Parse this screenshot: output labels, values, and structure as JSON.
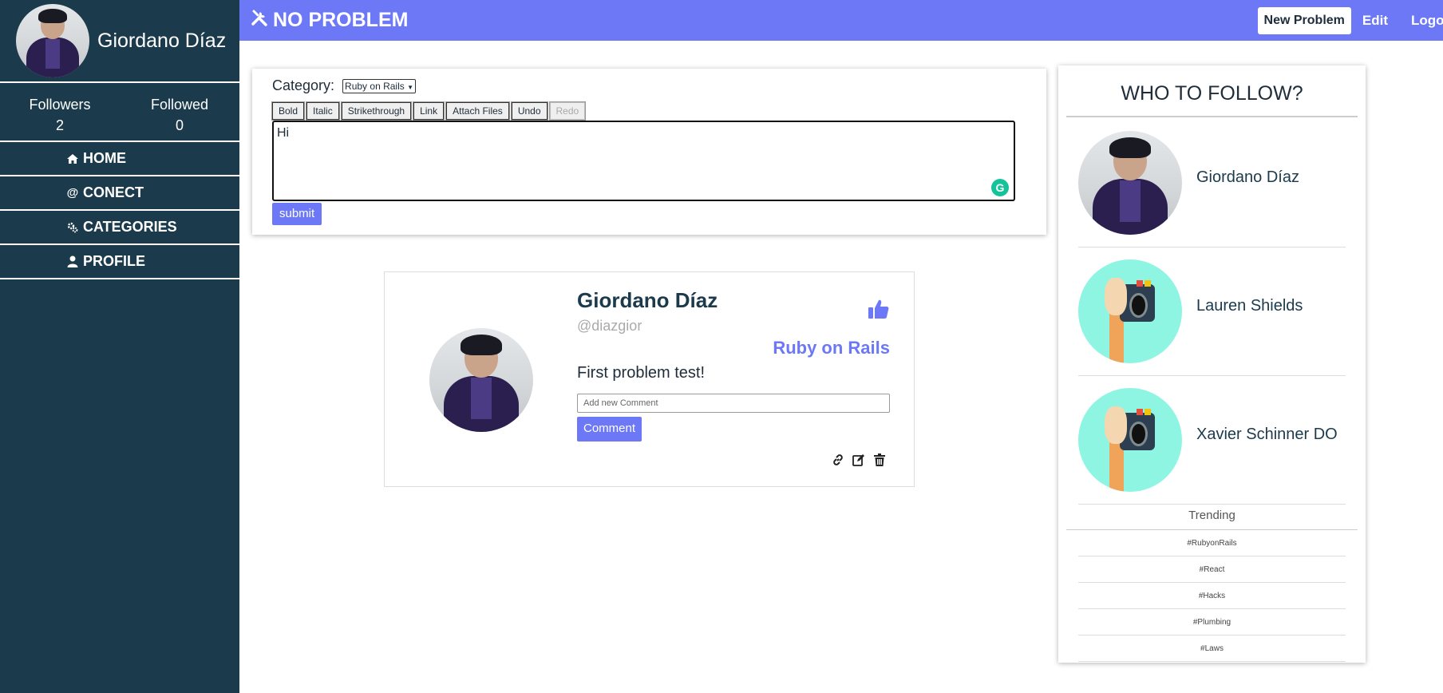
{
  "sidebar": {
    "user_name": "Giordano Díaz",
    "stats": [
      {
        "label": "Followers",
        "value": "2"
      },
      {
        "label": "Followed",
        "value": "0"
      }
    ],
    "nav": [
      {
        "label": "HOME",
        "icon": "home-icon"
      },
      {
        "label": "CONECT",
        "icon": "at-icon"
      },
      {
        "label": "CATEGORIES",
        "icon": "cogs-icon"
      },
      {
        "label": "PROFILE",
        "icon": "user-icon"
      }
    ]
  },
  "topbar": {
    "brand": "NO PROBLEM",
    "brand_icon": "tools-icon",
    "new_problem": "New Problem",
    "edit": "Edit",
    "logout": "Logout"
  },
  "composer": {
    "category_label": "Category:",
    "category_selected": "Ruby on Rails",
    "toolbar": [
      "Bold",
      "Italic",
      "Strikethrough",
      "Link",
      "Attach Files",
      "Undo",
      "Redo"
    ],
    "editor_text": "Hi",
    "submit_label": "submit"
  },
  "post": {
    "author": "Giordano Díaz",
    "handle": "@diazgior",
    "category": "Ruby on Rails",
    "body": "First problem test!",
    "comment_placeholder": "Add new Comment",
    "comment_button": "Comment",
    "actions": [
      "link-icon",
      "edit-icon",
      "trash-icon"
    ]
  },
  "who_to_follow": {
    "title": "WHO TO FOLLOW?",
    "users": [
      {
        "name": "Giordano Díaz",
        "avatar": "person-photo"
      },
      {
        "name": "Lauren Shields",
        "avatar": "camera-illustration"
      },
      {
        "name": "Xavier Schinner DO",
        "avatar": "camera-illustration"
      }
    ],
    "trending_title": "Trending",
    "trending": [
      "#RubyonRails",
      "#React",
      "#Hacks",
      "#Plumbing",
      "#Laws"
    ]
  },
  "colors": {
    "sidebar_bg": "#1b3a4b",
    "accent": "#6c78f6",
    "grammarly": "#15c39a"
  }
}
